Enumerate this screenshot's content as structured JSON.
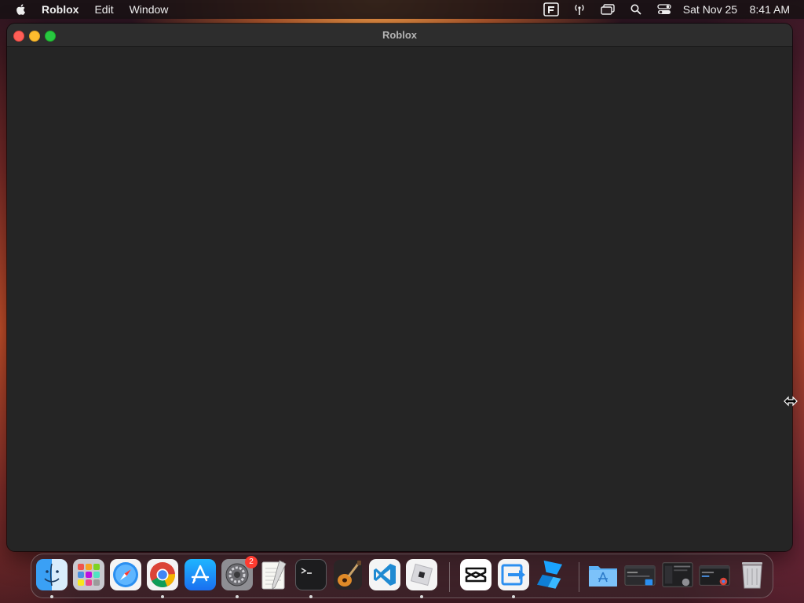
{
  "menubar": {
    "app_name": "Roblox",
    "items": [
      "Edit",
      "Window"
    ],
    "clock": {
      "date": "Sat Nov 25",
      "time": "8:41 AM"
    },
    "status_icons": [
      "app-status-icon",
      "antenna-icon",
      "screen-mirroring-icon",
      "spotlight-search-icon",
      "control-center-icon"
    ]
  },
  "window": {
    "title": "Roblox"
  },
  "dock": {
    "apps": [
      {
        "name": "Finder",
        "icon": "finder-icon",
        "running": true
      },
      {
        "name": "Launchpad",
        "icon": "launchpad-icon",
        "running": false
      },
      {
        "name": "Safari",
        "icon": "safari-icon",
        "running": false
      },
      {
        "name": "Google Chrome",
        "icon": "chrome-icon",
        "running": true
      },
      {
        "name": "App Store",
        "icon": "app-store-icon",
        "running": false
      },
      {
        "name": "System Settings",
        "icon": "system-settings-icon",
        "running": true,
        "badge": "2"
      },
      {
        "name": "TextEdit",
        "icon": "textedit-icon",
        "running": false
      },
      {
        "name": "Terminal",
        "icon": "terminal-icon",
        "running": true
      },
      {
        "name": "GarageBand",
        "icon": "garageband-icon",
        "running": false
      },
      {
        "name": "Visual Studio Code",
        "icon": "vscode-icon",
        "running": false
      },
      {
        "name": "Roblox",
        "icon": "roblox-icon",
        "running": true
      },
      {
        "name": "CapCut",
        "icon": "capcut-icon",
        "running": false
      },
      {
        "name": "Migration App",
        "icon": "migration-icon",
        "running": true
      },
      {
        "name": "Roblox Studio",
        "icon": "roblox-studio-icon",
        "running": false
      },
      {
        "name": "Applications",
        "icon": "applications-folder-icon",
        "running": false
      },
      {
        "name": "Window Preview 1",
        "icon": "window-thumbnail-icon",
        "running": false
      },
      {
        "name": "Window Preview 2",
        "icon": "window-thumbnail-icon",
        "running": false
      },
      {
        "name": "Window Preview 3",
        "icon": "window-thumbnail-icon",
        "running": false
      },
      {
        "name": "Trash",
        "icon": "trash-icon",
        "running": false
      }
    ]
  },
  "colors": {
    "window_bg": "#252525",
    "titlebar_bg": "#2d2d2d",
    "close": "#fe5f57",
    "minimize": "#febc2e",
    "maximize": "#28c840",
    "badge": "#ff3b30"
  }
}
